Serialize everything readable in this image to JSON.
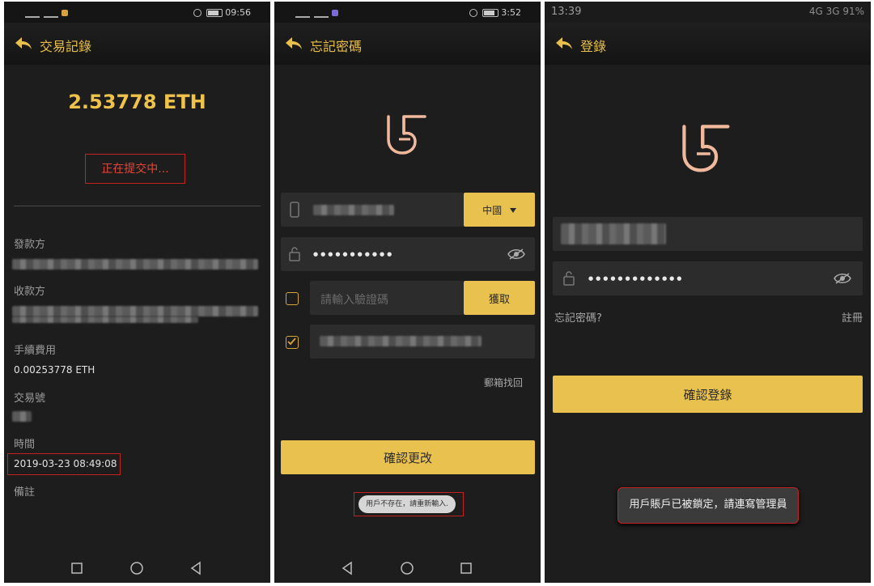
{
  "screen1": {
    "status_time": "09:56",
    "battery": "78",
    "title": "交易記錄",
    "amount": "2.53778 ETH",
    "status_text": "正在提交中...",
    "sender_label": "發款方",
    "receiver_label": "收款方",
    "fee_label": "手續費用",
    "fee_value": "0.00253778 ETH",
    "txid_label": "交易號",
    "time_label": "時間",
    "time_value": "2019-03-23 08:49:08",
    "note_label": "備註"
  },
  "screen2": {
    "status_time": "3:52",
    "title": "忘記密碼",
    "country_label": "中國",
    "password_dots": "●●●●●●●●●●●",
    "code_placeholder": "請輸入驗證碼",
    "get_code_label": "獲取",
    "email_link": "郵箱找回",
    "confirm_label": "確認更改",
    "toast": "用戶不存在，請重新輸入."
  },
  "screen3": {
    "status_time": "13:39",
    "status_right": "4G 3G 91%",
    "title": "登錄",
    "password_dots": "●●●●●●●●●●●●●",
    "forgot_label": "忘記密碼?",
    "register_label": "註冊",
    "login_label": "確認登錄",
    "toast": "用戶賬戶已被鎖定，請連寫管理員"
  },
  "colors": {
    "accent": "#e9c14e",
    "logo": "#f0b89c",
    "alert": "#c42222",
    "bg": "#1d1d1d"
  }
}
